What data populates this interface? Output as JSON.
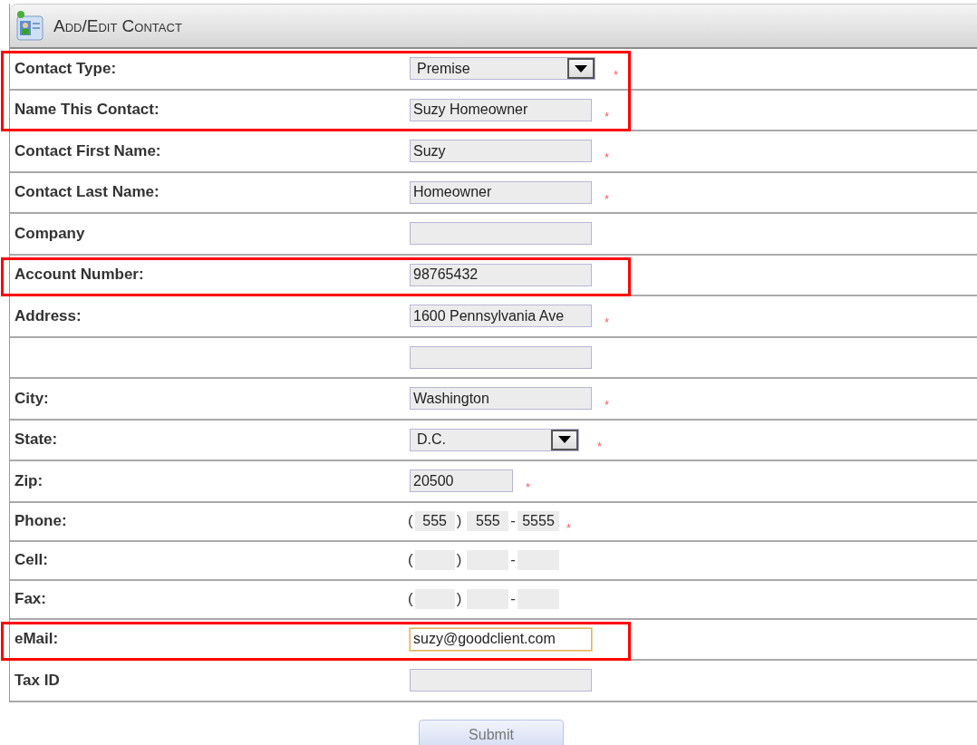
{
  "panel": {
    "title": "Add/Edit Contact"
  },
  "rows": [
    {
      "label": "Contact Type:",
      "kind": "select",
      "value": "Premise",
      "required": true,
      "highlighted": true
    },
    {
      "label": "Name This Contact:",
      "kind": "text",
      "value": "Suzy Homeowner",
      "required": true,
      "highlighted": true
    },
    {
      "label": "Contact First Name:",
      "kind": "text",
      "value": "Suzy",
      "required": true,
      "highlighted": false
    },
    {
      "label": "Contact Last Name:",
      "kind": "text",
      "value": "Homeowner",
      "required": true,
      "highlighted": false
    },
    {
      "label": "Company",
      "kind": "text",
      "required": false,
      "highlighted": false
    },
    {
      "label": "Account Number:",
      "kind": "text",
      "value": "98765432",
      "required": false,
      "highlighted": true
    },
    {
      "label": "Address:",
      "kind": "text",
      "value": "1600 Pennsylvania Ave",
      "required": true,
      "highlighted": false
    },
    {
      "kind": "text",
      "required": false,
      "highlighted": false
    },
    {
      "label": "City:",
      "kind": "text",
      "value": "Washington",
      "required": true,
      "highlighted": false
    },
    {
      "label": "State:",
      "kind": "select",
      "value": "D.C.",
      "required": true,
      "highlighted": false
    },
    {
      "label": "Zip:",
      "kind": "short",
      "value": "20500",
      "required": true,
      "highlighted": false
    },
    {
      "label": "Phone:",
      "kind": "phone",
      "separators": [
        "(",
        ")",
        "-"
      ],
      "parts": [
        "555",
        "555",
        "5555"
      ],
      "required": true,
      "highlighted": false
    },
    {
      "label": "Cell:",
      "kind": "phone",
      "separators": [
        "(",
        ")",
        "-"
      ],
      "required": false,
      "highlighted": false
    },
    {
      "label": "Fax:",
      "kind": "phone",
      "separators": [
        "(",
        ")",
        "-"
      ],
      "required": false,
      "highlighted": false
    },
    {
      "label": "eMail:",
      "kind": "text",
      "value": "suzy@goodclient.com",
      "focused": true,
      "required": false,
      "highlighted": true
    },
    {
      "label": "Tax ID",
      "kind": "text",
      "required": false,
      "highlighted": false
    }
  ],
  "submit": {
    "label": "Submit"
  },
  "required_mark": "*"
}
